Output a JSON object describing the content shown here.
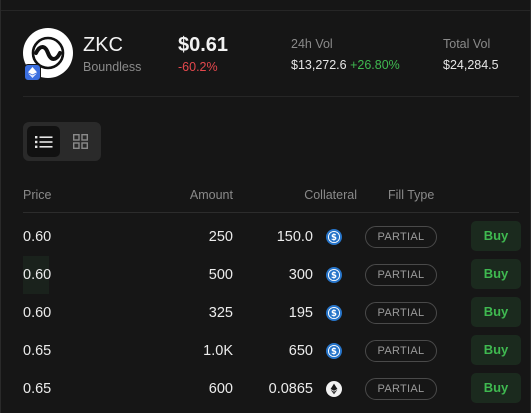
{
  "token": {
    "symbol": "ZKC",
    "name": "Boundless",
    "price": "$0.61",
    "change": "-60.2%",
    "logo_icon": "boundless-logo-icon",
    "chain_icon": "ethereum-icon"
  },
  "stats": {
    "vol24_label": "24h Vol",
    "vol24_value": "$13,272.6",
    "vol24_change": "+26.80%",
    "total_label": "Total Vol",
    "total_value": "$24,284.5"
  },
  "view_toggle": {
    "active": "list",
    "options": [
      "list-view-icon",
      "grid-view-icon"
    ]
  },
  "table": {
    "headers": {
      "price": "Price",
      "amount": "Amount",
      "collateral": "Collateral",
      "fill_type": "Fill Type"
    },
    "rows": [
      {
        "price": "0.60",
        "amount": "250",
        "collateral": "150.0",
        "collateral_icon": "usdc-icon",
        "fill_type": "PARTIAL",
        "action": "Buy"
      },
      {
        "price": "0.60",
        "amount": "500",
        "collateral": "300",
        "collateral_icon": "usdc-icon",
        "fill_type": "PARTIAL",
        "action": "Buy"
      },
      {
        "price": "0.60",
        "amount": "325",
        "collateral": "195",
        "collateral_icon": "usdc-icon",
        "fill_type": "PARTIAL",
        "action": "Buy"
      },
      {
        "price": "0.65",
        "amount": "1.0K",
        "collateral": "650",
        "collateral_icon": "usdc-icon",
        "fill_type": "PARTIAL",
        "action": "Buy"
      },
      {
        "price": "0.65",
        "amount": "600",
        "collateral": "0.0865",
        "collateral_icon": "ethereum-icon",
        "fill_type": "PARTIAL",
        "action": "Buy"
      }
    ]
  },
  "colors": {
    "background": "#161616",
    "positive": "#3fb950",
    "negative": "#e5484d",
    "usdc": "#2775ca"
  }
}
